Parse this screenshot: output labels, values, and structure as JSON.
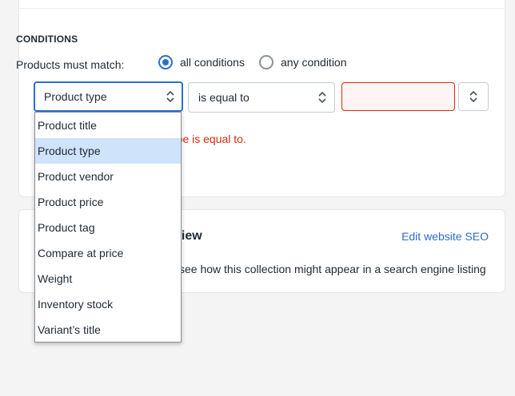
{
  "conditions": {
    "heading": "CONDITIONS",
    "match_label": "Products must match:",
    "radio_all": "all conditions",
    "radio_any": "any condition",
    "field_select": "Product type",
    "operator_select": "is equal to",
    "value_input": "",
    "error_message": "ct type is equal to."
  },
  "dropdown": {
    "options": [
      "Product title",
      "Product type",
      "Product vendor",
      "Product price",
      "Product tag",
      "Compare at price",
      "Weight",
      "Inventory stock",
      "Variant’s title"
    ],
    "selected": "Product type"
  },
  "seo": {
    "title_visible": "view",
    "edit_link": "Edit website SEO",
    "description_visible": "see how this collection might appear in a search engine listing"
  },
  "colors": {
    "accent": "#2c6ecb",
    "error": "#d72c0d",
    "highlight": "#cfe3fb"
  }
}
